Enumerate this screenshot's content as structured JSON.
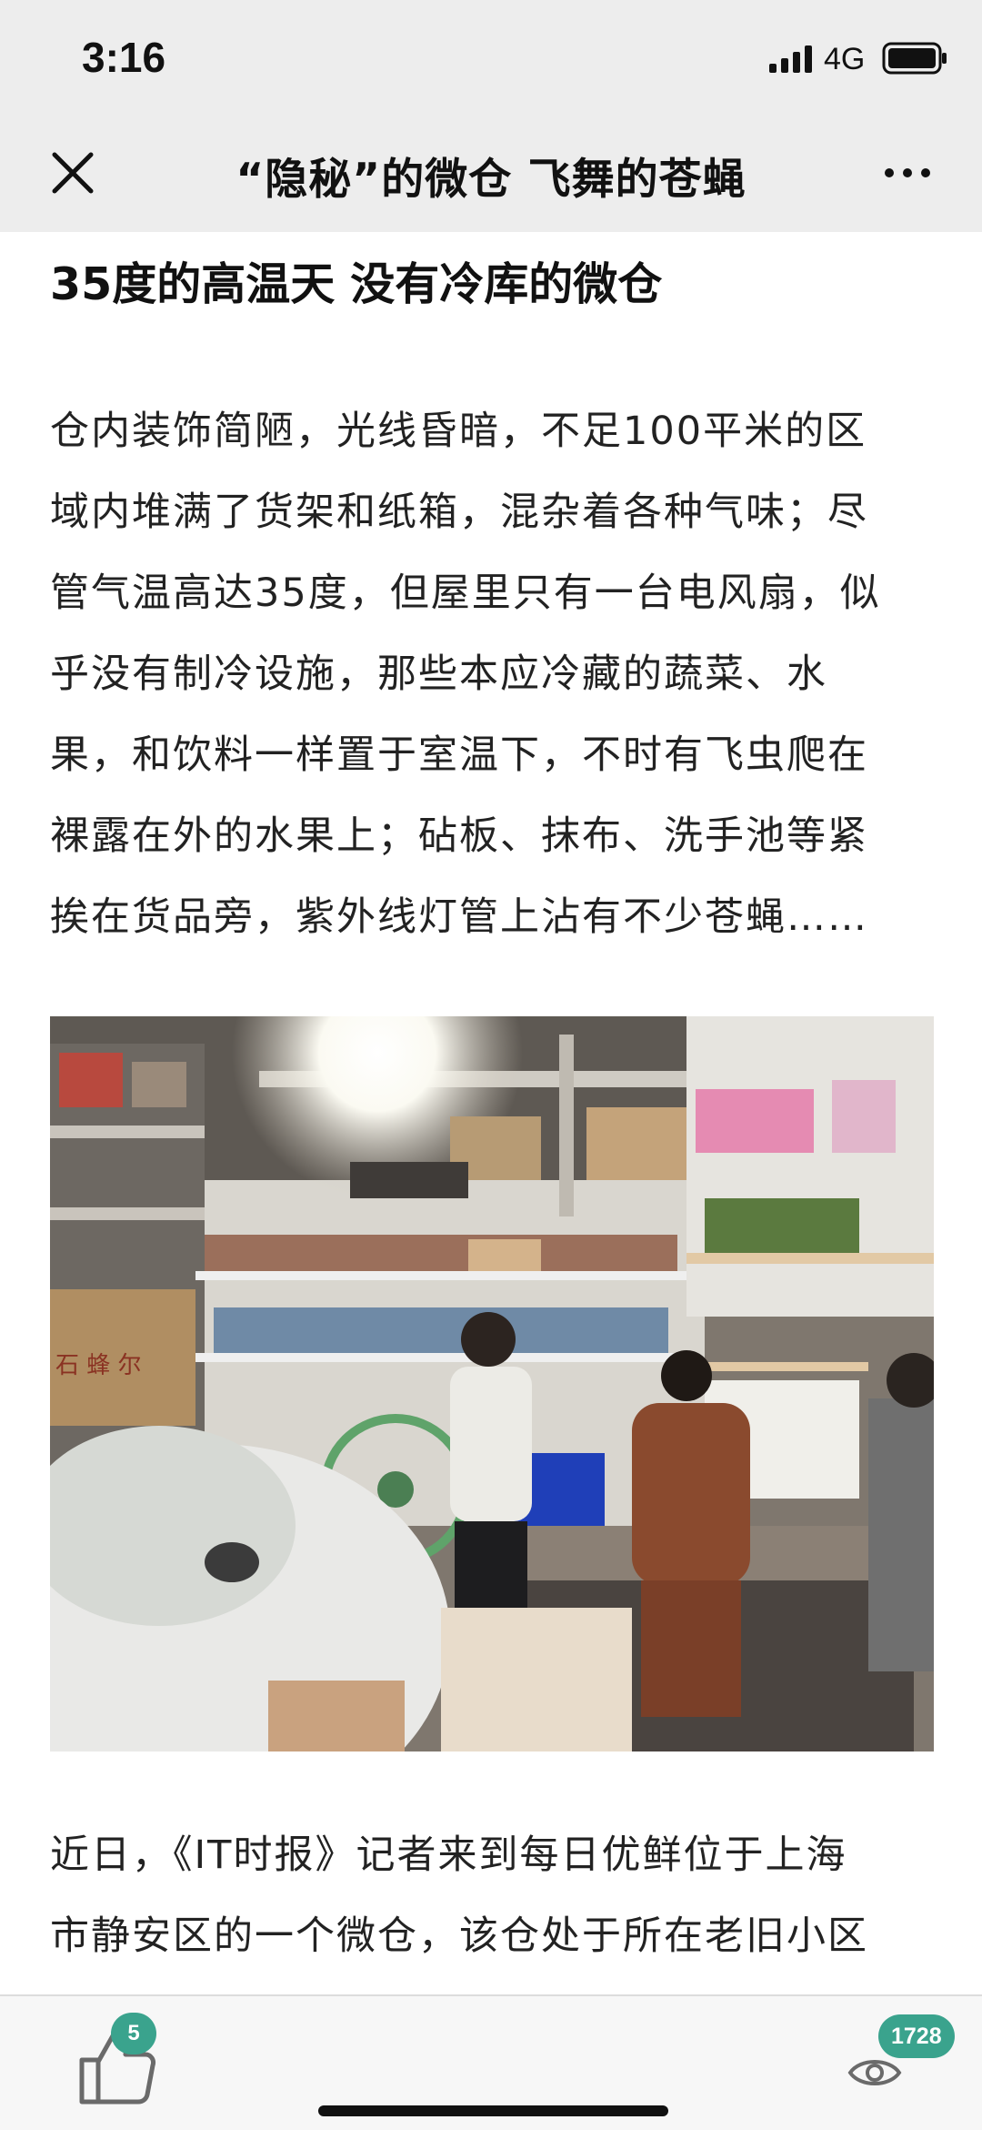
{
  "status_bar": {
    "time": "3:16",
    "network": "4G"
  },
  "nav": {
    "title": "“隐秘”的微仓 飞舞的苍蝇"
  },
  "article": {
    "heading": "35度的高温天  没有冷库的微仓",
    "paragraph_1_lines": [
      "仓内装饰简陋，光线昏暗，不足100平米的区",
      "域内堆满了货架和纸箱，混杂着各种气味；尽",
      "管气温高达35度，但屋里只有一台电风扇，似",
      "乎没有制冷设施，那些本应冷藏的蔬菜、水",
      "果，和饮料一样置于室温下，不时有飞虫爬在",
      "裸露在外的水果上；砧板、抹布、洗手池等紧",
      "挨在货品旁，紫外线灯管上沾有不少苍蝇……"
    ],
    "paragraph_2_lines": [
      "近日，《IT时报》记者来到每日优鲜位于上海",
      "市静安区的一个微仓，该仓处于所在老旧小区"
    ],
    "photo_text": {
      "box_label": "石 蜂 尔"
    }
  },
  "bottom_bar": {
    "likes": "5",
    "views": "1728"
  },
  "colors": {
    "badge": "#3aa38d",
    "top_bar": "#ededed"
  }
}
